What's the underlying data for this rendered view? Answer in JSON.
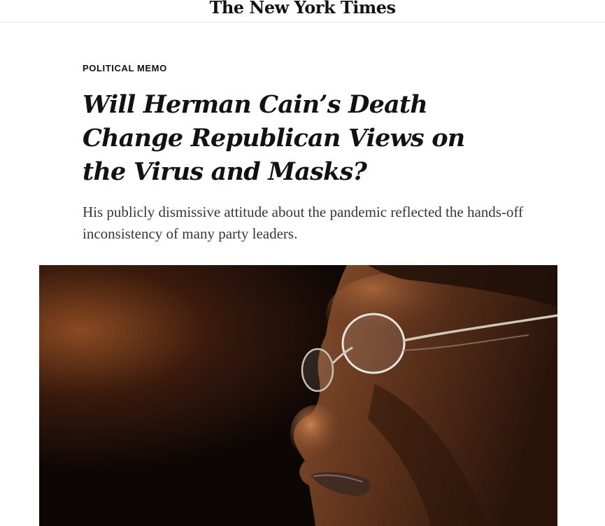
{
  "masthead": {
    "logo_text": "The New York Times"
  },
  "article": {
    "kicker": "POLITICAL MEMO",
    "headline": "Will Herman Cain’s Death Change Republican Views on the Virus and Masks?",
    "summary": "His publicly dismissive attitude about the pandemic reflected the hands-off inconsistency of many party leaders."
  },
  "colors": {
    "text": "#121212",
    "summary_text": "#363636",
    "divider": "#e2e2e2",
    "photo_background": "#0c0605",
    "skin_tone": "#7a4628"
  },
  "lead_image": {
    "subject": "close-up profile portrait of a man wearing rimless glasses against a dark background"
  }
}
